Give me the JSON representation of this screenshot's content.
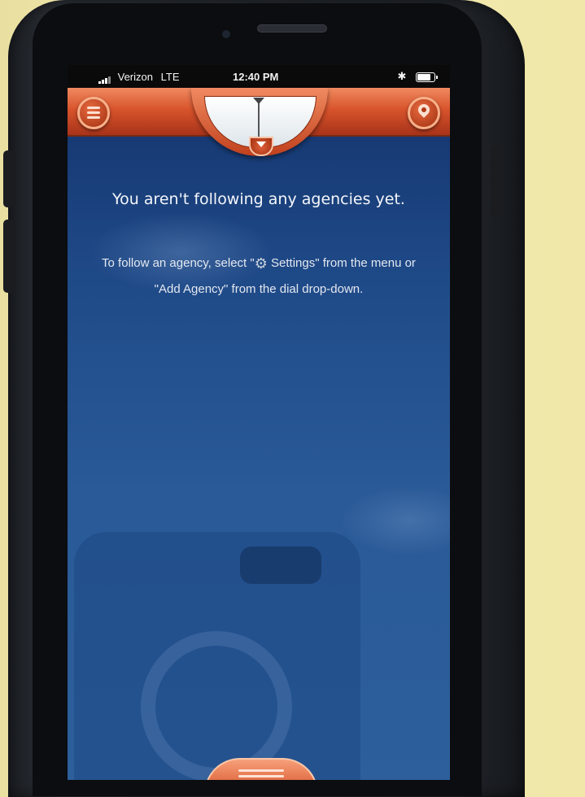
{
  "status_bar": {
    "carrier": "Verizon",
    "network": "LTE",
    "time": "12:40 PM"
  },
  "nav": {
    "menu_icon": "hamburger-menu-icon",
    "location_icon": "location-pin-icon",
    "dial_icon": "agency-dial-icon"
  },
  "empty_state": {
    "title": "You aren't following any agencies yet.",
    "body_before": "To follow an agency, select \"",
    "settings_label": " Settings",
    "body_after": "\" from the menu or \"Add Agency\" from the dial drop-down.",
    "settings_icon": "gear-icon"
  },
  "colors": {
    "nav_orange": "#d8542c",
    "screen_blue": "#1f4a88",
    "text_white": "#f4f6fa"
  }
}
